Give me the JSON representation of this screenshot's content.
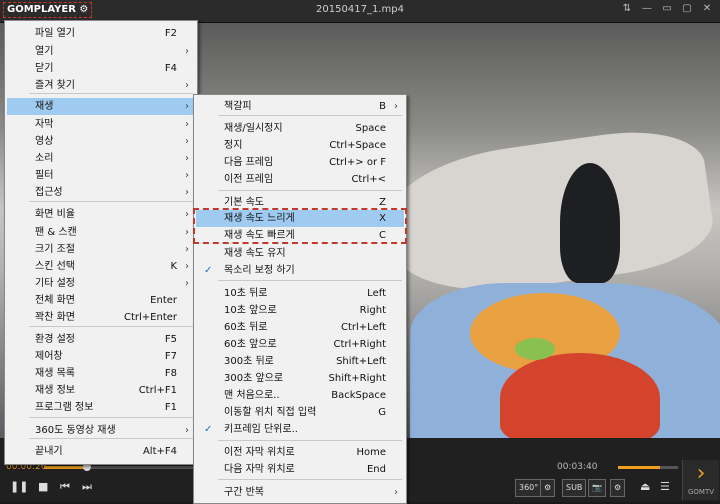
{
  "titlebar": {
    "logo": "GOMPLAYER",
    "title": "20150417_1.mp4",
    "controls": [
      "⇅",
      "—",
      "▭",
      "▢",
      "✕"
    ]
  },
  "player": {
    "time_elapsed": "00:00:26",
    "time_total": "00:03:40",
    "seek_progress": 0.12,
    "volume_level": 0.7,
    "chips": [
      "360°",
      "⚙",
      "SUB",
      "📷",
      "⚙"
    ],
    "gomtv_label": "GOMTV"
  },
  "main_menu": {
    "items": [
      {
        "label": "파일 열기",
        "shortcut": "F2",
        "arrow": ""
      },
      {
        "label": "열기",
        "shortcut": "",
        "arrow": "›"
      },
      {
        "label": "닫기",
        "shortcut": "F4",
        "arrow": ""
      },
      {
        "label": "즐겨 찾기",
        "shortcut": "",
        "arrow": "›"
      },
      {
        "label": "재생",
        "shortcut": "",
        "arrow": "›"
      },
      {
        "label": "자막",
        "shortcut": "",
        "arrow": "›"
      },
      {
        "label": "영상",
        "shortcut": "",
        "arrow": "›"
      },
      {
        "label": "소리",
        "shortcut": "",
        "arrow": "›"
      },
      {
        "label": "필터",
        "shortcut": "",
        "arrow": "›"
      },
      {
        "label": "접근성",
        "shortcut": "",
        "arrow": "›"
      },
      {
        "label": "화면 비율",
        "shortcut": "",
        "arrow": "›"
      },
      {
        "label": "팬 & 스캔",
        "shortcut": "",
        "arrow": "›"
      },
      {
        "label": "크기 조절",
        "shortcut": "",
        "arrow": "›"
      },
      {
        "label": "스킨 선택",
        "shortcut": "K",
        "arrow": "›"
      },
      {
        "label": "기타 설정",
        "shortcut": "",
        "arrow": "›"
      },
      {
        "label": "전체 화면",
        "shortcut": "Enter",
        "arrow": ""
      },
      {
        "label": "꽉찬 화면",
        "shortcut": "Ctrl+Enter",
        "arrow": ""
      },
      {
        "label": "환경 설정",
        "shortcut": "F5",
        "arrow": ""
      },
      {
        "label": "제어창",
        "shortcut": "F7",
        "arrow": ""
      },
      {
        "label": "재생 목록",
        "shortcut": "F8",
        "arrow": ""
      },
      {
        "label": "재생 정보",
        "shortcut": "Ctrl+F1",
        "arrow": ""
      },
      {
        "label": "프로그램 정보",
        "shortcut": "F1",
        "arrow": ""
      },
      {
        "label": "360도 동영상 재생",
        "shortcut": "",
        "arrow": "›"
      },
      {
        "label": "끝내기",
        "shortcut": "Alt+F4",
        "arrow": ""
      }
    ]
  },
  "play_submenu": {
    "items": [
      {
        "label": "책갈피",
        "shortcut": "B",
        "arrow": "›",
        "checked": ""
      },
      {
        "label": "재생/일시정지",
        "shortcut": "Space",
        "arrow": "",
        "checked": ""
      },
      {
        "label": "정지",
        "shortcut": "Ctrl+Space",
        "arrow": "",
        "checked": ""
      },
      {
        "label": "다음 프레임",
        "shortcut": "Ctrl+> or F",
        "arrow": "",
        "checked": ""
      },
      {
        "label": "이전 프레임",
        "shortcut": "Ctrl+<",
        "arrow": "",
        "checked": ""
      },
      {
        "label": "기본 속도",
        "shortcut": "Z",
        "arrow": "",
        "checked": ""
      },
      {
        "label": "재생 속도 느리게",
        "shortcut": "X",
        "arrow": "",
        "checked": ""
      },
      {
        "label": "재생 속도 빠르게",
        "shortcut": "C",
        "arrow": "",
        "checked": ""
      },
      {
        "label": "재생 속도 유지",
        "shortcut": "",
        "arrow": "",
        "checked": ""
      },
      {
        "label": "목소리 보정 하기",
        "shortcut": "",
        "arrow": "",
        "checked": "✓"
      },
      {
        "label": "10초 뒤로",
        "shortcut": "Left",
        "arrow": "",
        "checked": ""
      },
      {
        "label": "10초 앞으로",
        "shortcut": "Right",
        "arrow": "",
        "checked": ""
      },
      {
        "label": "60초 뒤로",
        "shortcut": "Ctrl+Left",
        "arrow": "",
        "checked": ""
      },
      {
        "label": "60초 앞으로",
        "shortcut": "Ctrl+Right",
        "arrow": "",
        "checked": ""
      },
      {
        "label": "300초 뒤로",
        "shortcut": "Shift+Left",
        "arrow": "",
        "checked": ""
      },
      {
        "label": "300초 앞으로",
        "shortcut": "Shift+Right",
        "arrow": "",
        "checked": ""
      },
      {
        "label": "맨 처음으로..",
        "shortcut": "BackSpace",
        "arrow": "",
        "checked": ""
      },
      {
        "label": "이동할 위치 직접 입력",
        "shortcut": "G",
        "arrow": "",
        "checked": ""
      },
      {
        "label": "키프레임 단위로..",
        "shortcut": "",
        "arrow": "",
        "checked": "✓"
      },
      {
        "label": "이전 자막 위치로",
        "shortcut": "Home",
        "arrow": "",
        "checked": ""
      },
      {
        "label": "다음 자막 위치로",
        "shortcut": "End",
        "arrow": "",
        "checked": ""
      },
      {
        "label": "구간 반복",
        "shortcut": "",
        "arrow": "›",
        "checked": ""
      }
    ]
  }
}
